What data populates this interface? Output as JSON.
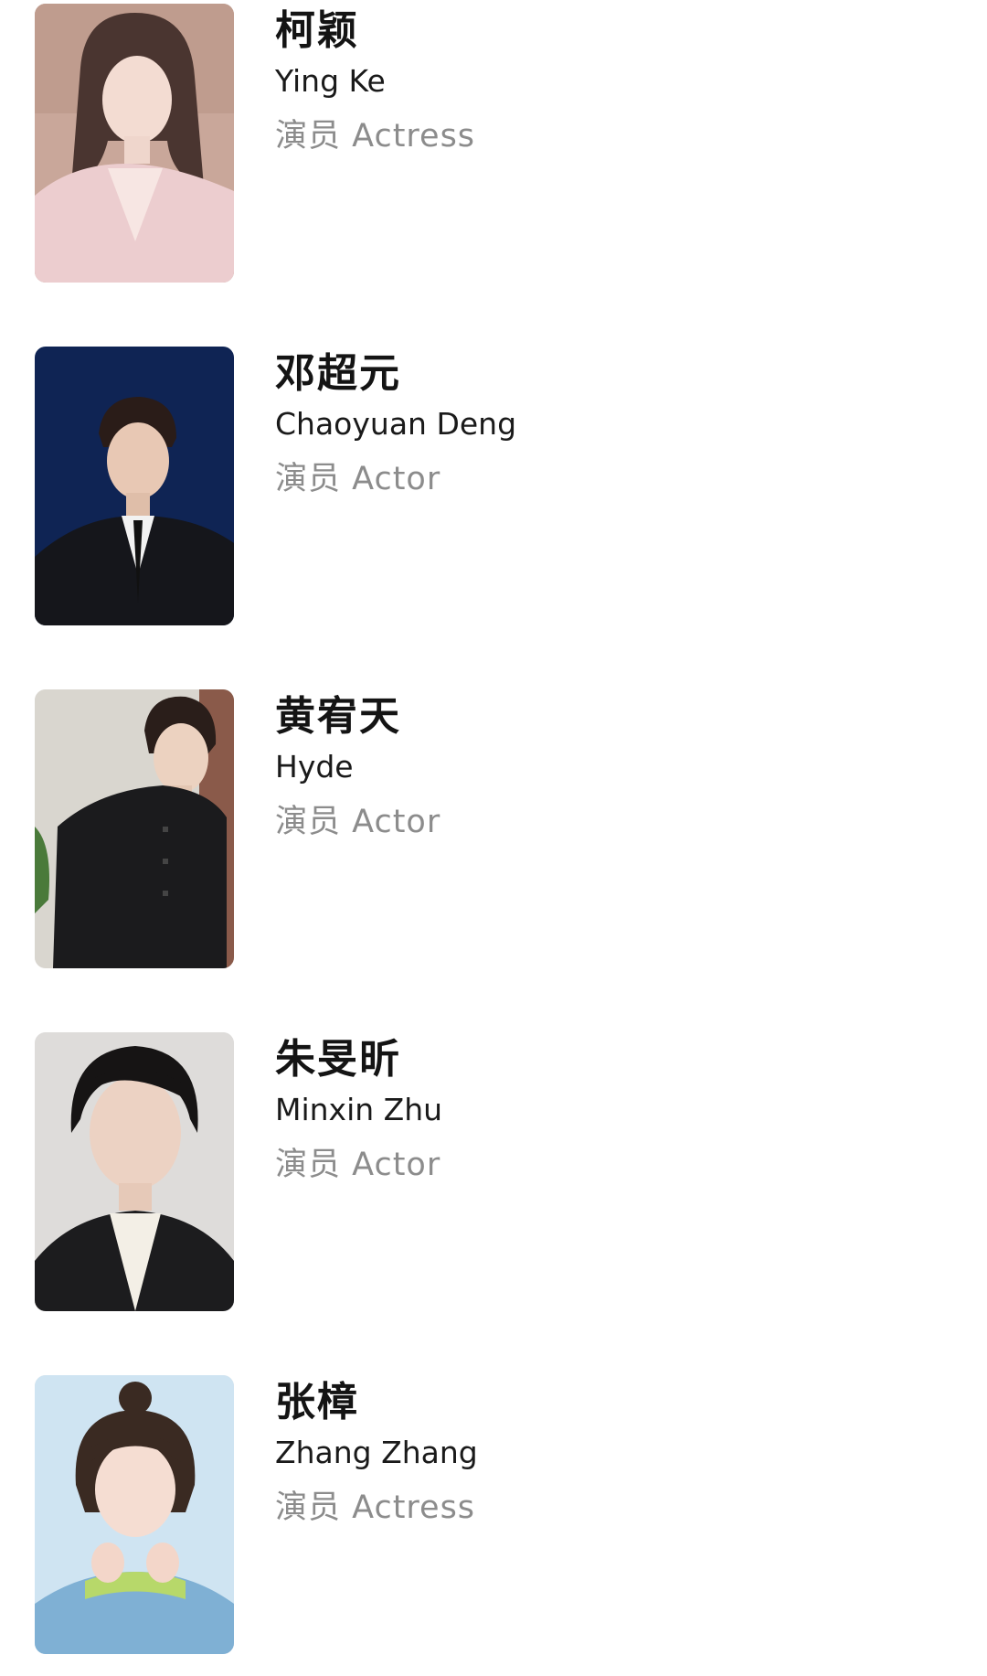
{
  "cast": [
    {
      "name_cn": "柯颖",
      "name_en": "Ying Ke",
      "role": "演员 Actress",
      "photo": "portrait-actress-1"
    },
    {
      "name_cn": "邓超元",
      "name_en": "Chaoyuan Deng",
      "role": "演员 Actor",
      "photo": "portrait-actor-1"
    },
    {
      "name_cn": "黄宥天",
      "name_en": "Hyde",
      "role": "演员 Actor",
      "photo": "portrait-actor-2"
    },
    {
      "name_cn": "朱旻昕",
      "name_en": "Minxin Zhu",
      "role": "演员 Actor",
      "photo": "portrait-actor-3"
    },
    {
      "name_cn": "张樟",
      "name_en": "Zhang Zhang",
      "role": "演员 Actress",
      "photo": "portrait-actress-2"
    }
  ],
  "colors": {
    "background": "#ffffff",
    "name": "#141414",
    "role": "#8c8c8c"
  }
}
